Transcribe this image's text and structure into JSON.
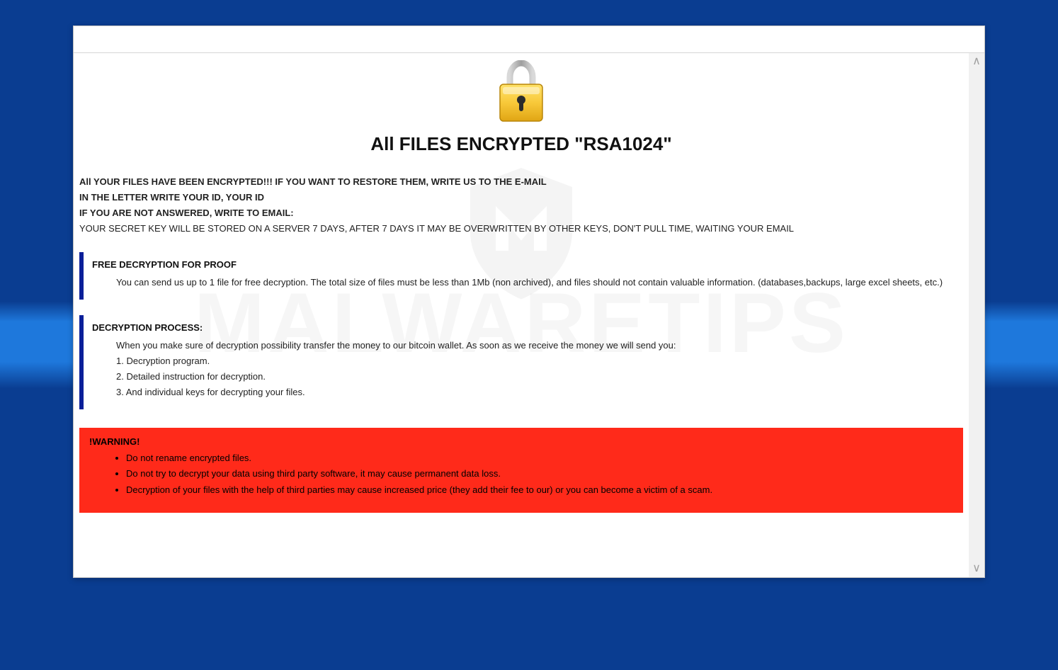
{
  "heading": "All FILES ENCRYPTED \"RSA1024\"",
  "intro": {
    "line1": "All YOUR FILES HAVE BEEN ENCRYPTED!!! IF YOU WANT TO RESTORE THEM, WRITE US TO THE E-MAIL",
    "line2": "IN THE LETTER WRITE YOUR ID, YOUR ID",
    "line3": "IF YOU ARE NOT ANSWERED, WRITE TO EMAIL:",
    "line4": "YOUR SECRET KEY WILL BE STORED ON A SERVER 7 DAYS, AFTER 7 DAYS IT MAY BE OVERWRITTEN BY OTHER KEYS, DON'T PULL TIME, WAITING YOUR EMAIL"
  },
  "free": {
    "title": "FREE DECRYPTION FOR PROOF",
    "body": "You can send us up to 1 file for free decryption. The total size of files must be less than 1Mb (non archived), and files should not contain valuable information. (databases,backups, large excel sheets, etc.)"
  },
  "process": {
    "title": "DECRYPTION PROCESS:",
    "lead": "When you make sure of decryption possibility transfer the money to our bitcoin wallet. As soon as we receive the money we will send you:",
    "item1": "1. Decryption program.",
    "item2": "2. Detailed instruction for decryption.",
    "item3": "3. And individual keys for decrypting your files."
  },
  "warning": {
    "title": "!WARNING!",
    "item1": "Do not rename encrypted files.",
    "item2": "Do not try to decrypt your data using third party software, it may cause permanent data loss.",
    "item3": "Decryption of your files with the help of third parties may cause increased price (they add their fee to our) or you can become a victim of a scam."
  },
  "watermark": "MALWARETIPS"
}
